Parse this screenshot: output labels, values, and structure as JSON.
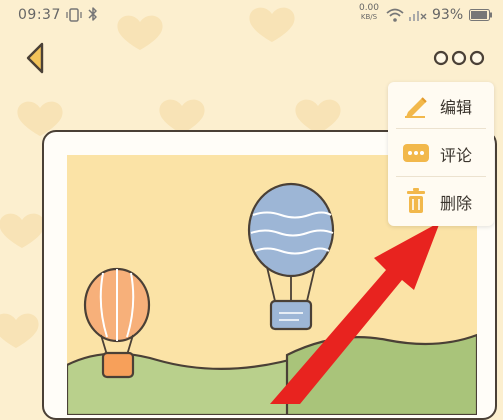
{
  "status_bar": {
    "time": "09:37",
    "network_speed_value": "0.00",
    "network_speed_unit": "KB/S",
    "battery_percent": "93%"
  },
  "navigation": {
    "back_icon": "chevron-left-icon",
    "more_icon": "three-dots-icon"
  },
  "context_menu": {
    "items": [
      {
        "label": "编辑",
        "icon": "pencil-icon"
      },
      {
        "label": "评论",
        "icon": "comment-dots-icon"
      },
      {
        "label": "删除",
        "icon": "trash-icon"
      }
    ]
  },
  "colors": {
    "background": "#fcefcf",
    "accent": "#f2b84b",
    "arrow": "#e8231f"
  }
}
